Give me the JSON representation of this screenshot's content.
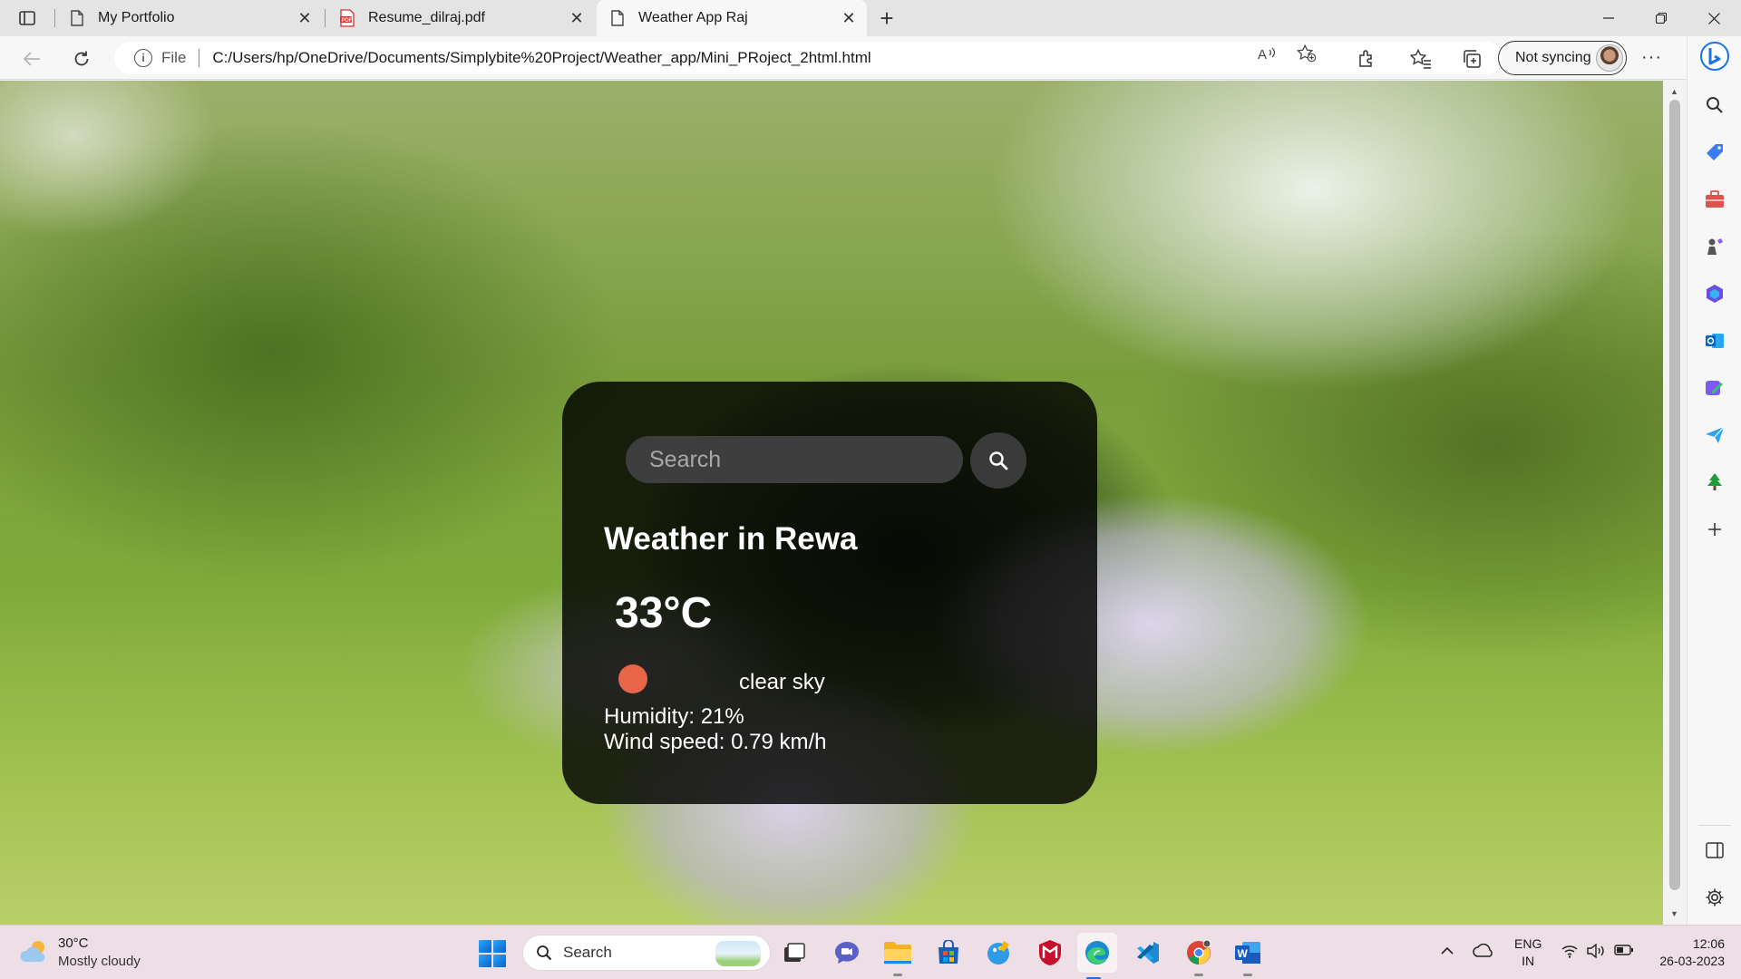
{
  "browser": {
    "tabs": [
      {
        "title": "My Portfolio",
        "icon": "page-icon",
        "active": false
      },
      {
        "title": "Resume_dilraj.pdf",
        "icon": "pdf-icon",
        "active": false
      },
      {
        "title": "Weather App Raj",
        "icon": "page-icon",
        "active": true
      }
    ],
    "address": {
      "scheme_label": "File",
      "url": "C:/Users/hp/OneDrive/Documents/Simplybite%20Project/Weather_app/Mini_PRoject_2html.html"
    },
    "sync_label": "Not syncing"
  },
  "weather_app": {
    "search_placeholder": "Search",
    "city_heading": "Weather in Rewa",
    "temperature": "33°C",
    "description": "clear sky",
    "humidity": "Humidity: 21%",
    "wind": "Wind speed: 0.79 km/h",
    "icon_color": "#e8654a"
  },
  "taskbar": {
    "weather_temp": "30°C",
    "weather_desc": "Mostly cloudy",
    "search_label": "Search",
    "lang_line1": "ENG",
    "lang_line2": "IN",
    "time": "12:06",
    "date": "26-03-2023",
    "apps": [
      "file-explorer-icon",
      "teams-chat-icon",
      "folder-icon",
      "store-icon",
      "paint-icon",
      "mcafee-icon",
      "edge-icon",
      "vscode-icon",
      "chrome-icon",
      "word-icon"
    ]
  }
}
